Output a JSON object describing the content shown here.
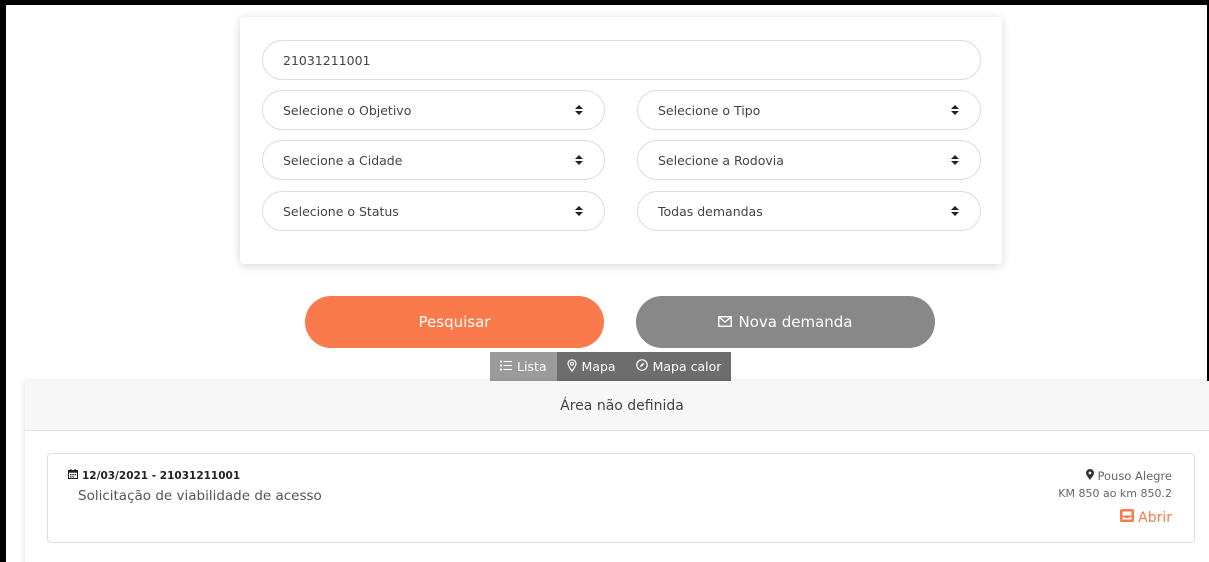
{
  "search": {
    "value": "21031211001"
  },
  "filters": {
    "objetivo": "Selecione o Objetivo",
    "tipo": "Selecione o Tipo",
    "cidade": "Selecione a Cidade",
    "rodovia": "Selecione a Rodovia",
    "status": "Selecione o Status",
    "demandas": "Todas demandas"
  },
  "buttons": {
    "search": "Pesquisar",
    "new_demand": "Nova demanda"
  },
  "views": {
    "list": "Lista",
    "map": "Mapa",
    "heatmap": "Mapa calor",
    "active": "list"
  },
  "panel": {
    "title": "Área não definida"
  },
  "demands": [
    {
      "date_id": "12/03/2021 - 21031211001",
      "description": "Solicitação de viabilidade de acesso",
      "city": "Pouso Alegre",
      "km": "KM 850 ao km 850.2",
      "open_label": "Abrir"
    }
  ],
  "colors": {
    "accent": "#fa7a4b",
    "secondary": "#888888"
  }
}
